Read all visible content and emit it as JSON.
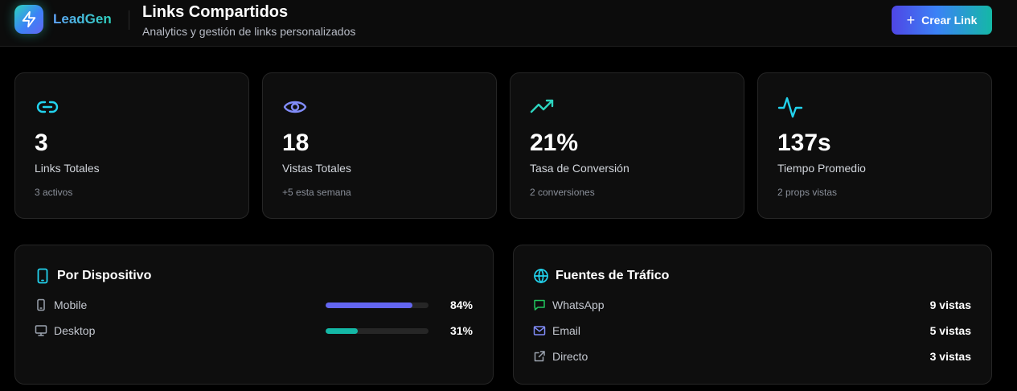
{
  "header": {
    "brand": "LeadGen",
    "title": "Links Compartidos",
    "subtitle": "Analytics y gestión de links personalizados",
    "create_button": "Crear Link"
  },
  "stats": [
    {
      "icon": "link-icon",
      "value": "3",
      "label": "Links Totales",
      "sub": "3 activos",
      "color": "#22d3ee"
    },
    {
      "icon": "eye-icon",
      "value": "18",
      "label": "Vistas Totales",
      "sub": "+5 esta semana",
      "color": "#818cf8"
    },
    {
      "icon": "trending-up-icon",
      "value": "21%",
      "label": "Tasa de Conversión",
      "sub": "2 conversiones",
      "color": "#2dd4bf"
    },
    {
      "icon": "activity-icon",
      "value": "137s",
      "label": "Tiempo Promedio",
      "sub": "2 props vistas",
      "color": "#22d3ee"
    }
  ],
  "devices": {
    "title": "Por Dispositivo",
    "items": [
      {
        "icon": "smartphone-icon",
        "label": "Mobile",
        "percent_text": "84%",
        "fill_fraction": 0.84,
        "color": "#6366f1"
      },
      {
        "icon": "monitor-icon",
        "label": "Desktop",
        "percent_text": "31%",
        "fill_fraction": 0.31,
        "color": "#14b8a6"
      }
    ]
  },
  "traffic": {
    "title": "Fuentes de Tráfico",
    "items": [
      {
        "icon": "message-icon",
        "label": "WhatsApp",
        "value": "9 vistas",
        "color": "#22c55e"
      },
      {
        "icon": "mail-icon",
        "label": "Email",
        "value": "5 vistas",
        "color": "#818cf8"
      },
      {
        "icon": "external-link-icon",
        "label": "Directo",
        "value": "3 vistas",
        "color": "#9ca3af"
      }
    ]
  }
}
